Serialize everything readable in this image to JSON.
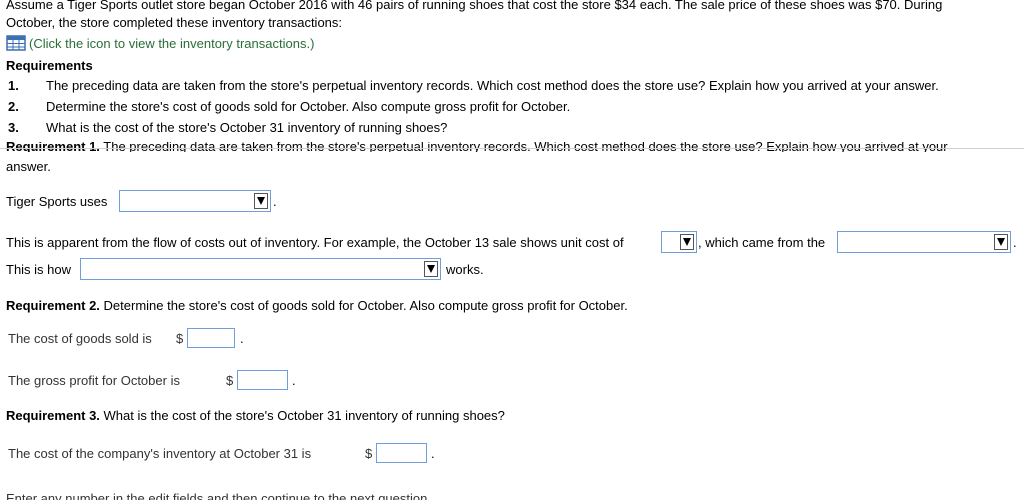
{
  "intro": {
    "line1": "Assume a Tiger Sports outlet store began October 2016 with 46 pairs of running shoes that cost the store $34 each. The sale price of these shoes was $70. During",
    "line2": "October, the store completed these inventory transactions:"
  },
  "link": {
    "icon": "table-icon",
    "text": "(Click the icon to view the inventory transactions.)"
  },
  "requirements": {
    "heading": "Requirements",
    "items": [
      {
        "num": "1.",
        "text": "The preceding data are taken from the store's perpetual inventory records. Which cost method does the store use? Explain how you arrived at your answer."
      },
      {
        "num": "2.",
        "text": "Determine the store's cost of goods sold for October. Also compute gross profit for October."
      },
      {
        "num": "3.",
        "text": "What is the cost of the store's October 31 inventory of running shoes?"
      }
    ]
  },
  "req1_section": {
    "cut_label": "Requirement 1.",
    "cut_text": " The preceding data are taken from the store's perpetual inventory records. Which cost method does the store use? Explain how you arrived at your",
    "answer_word": "answer.",
    "uses_label": "Tiger Sports uses",
    "period": ".",
    "apparent_text": "This is apparent from the flow of costs out of inventory. For example, the October 13 sale shows unit cost of",
    "which_came_text": ", which came from the",
    "this_is_how": "This is how",
    "works": "works."
  },
  "req2_section": {
    "heading_bold": "Requirement 2.",
    "heading_text": " Determine the store's cost of goods sold for October. Also compute gross profit for October.",
    "cogs_label": "The cost of goods sold is",
    "gross_label": "The gross profit for October is",
    "currency": "$",
    "period": "."
  },
  "req3_section": {
    "heading_bold": "Requirement 3.",
    "heading_text": " What is the cost of the store's October 31 inventory of running shoes?",
    "inventory_label": "The cost of the company's inventory at October 31 is",
    "currency": "$",
    "period": "."
  },
  "footer": {
    "cut_text": "Enter any number in the edit fields and then continue to the next question."
  }
}
